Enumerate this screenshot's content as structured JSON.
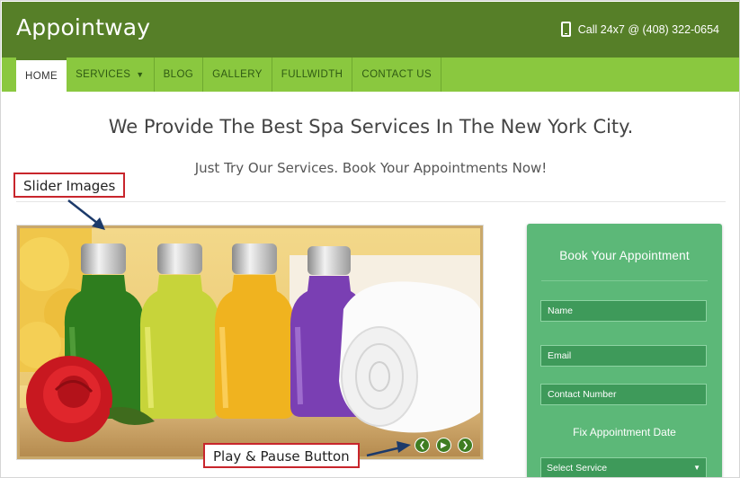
{
  "header": {
    "logo": "Appointway",
    "phone_text": "Call 24x7 @ (408) 322-0654"
  },
  "nav": {
    "items": [
      {
        "label": "HOME",
        "active": true
      },
      {
        "label": "SERVICES",
        "has_dropdown": true
      },
      {
        "label": "BLOG"
      },
      {
        "label": "GALLERY"
      },
      {
        "label": "FULLWIDTH"
      },
      {
        "label": "CONTACT US"
      }
    ]
  },
  "hero": {
    "headline": "We Provide The Best Spa Services In The New York City.",
    "subheadline": "Just Try Our Services. Book Your Appointments Now!"
  },
  "slider": {
    "image": "spa-oil-bottles-towel-rose",
    "controls": [
      "prev-icon",
      "play-icon",
      "next-icon"
    ]
  },
  "annotations": {
    "slider_images": "Slider Images",
    "play_pause": "Play & Pause Button",
    "color": "#c8252c"
  },
  "booking": {
    "title": "Book Your Appointment",
    "name_placeholder": "Name",
    "email_placeholder": "Email",
    "contact_placeholder": "Contact Number",
    "date_label": "Fix Appointment Date",
    "service_select": "Select Service"
  },
  "colors": {
    "header_bg": "#567f28",
    "nav_bg": "#8ac83f",
    "panel_bg": "#5cb878",
    "field_bg": "#3e9a5a"
  }
}
